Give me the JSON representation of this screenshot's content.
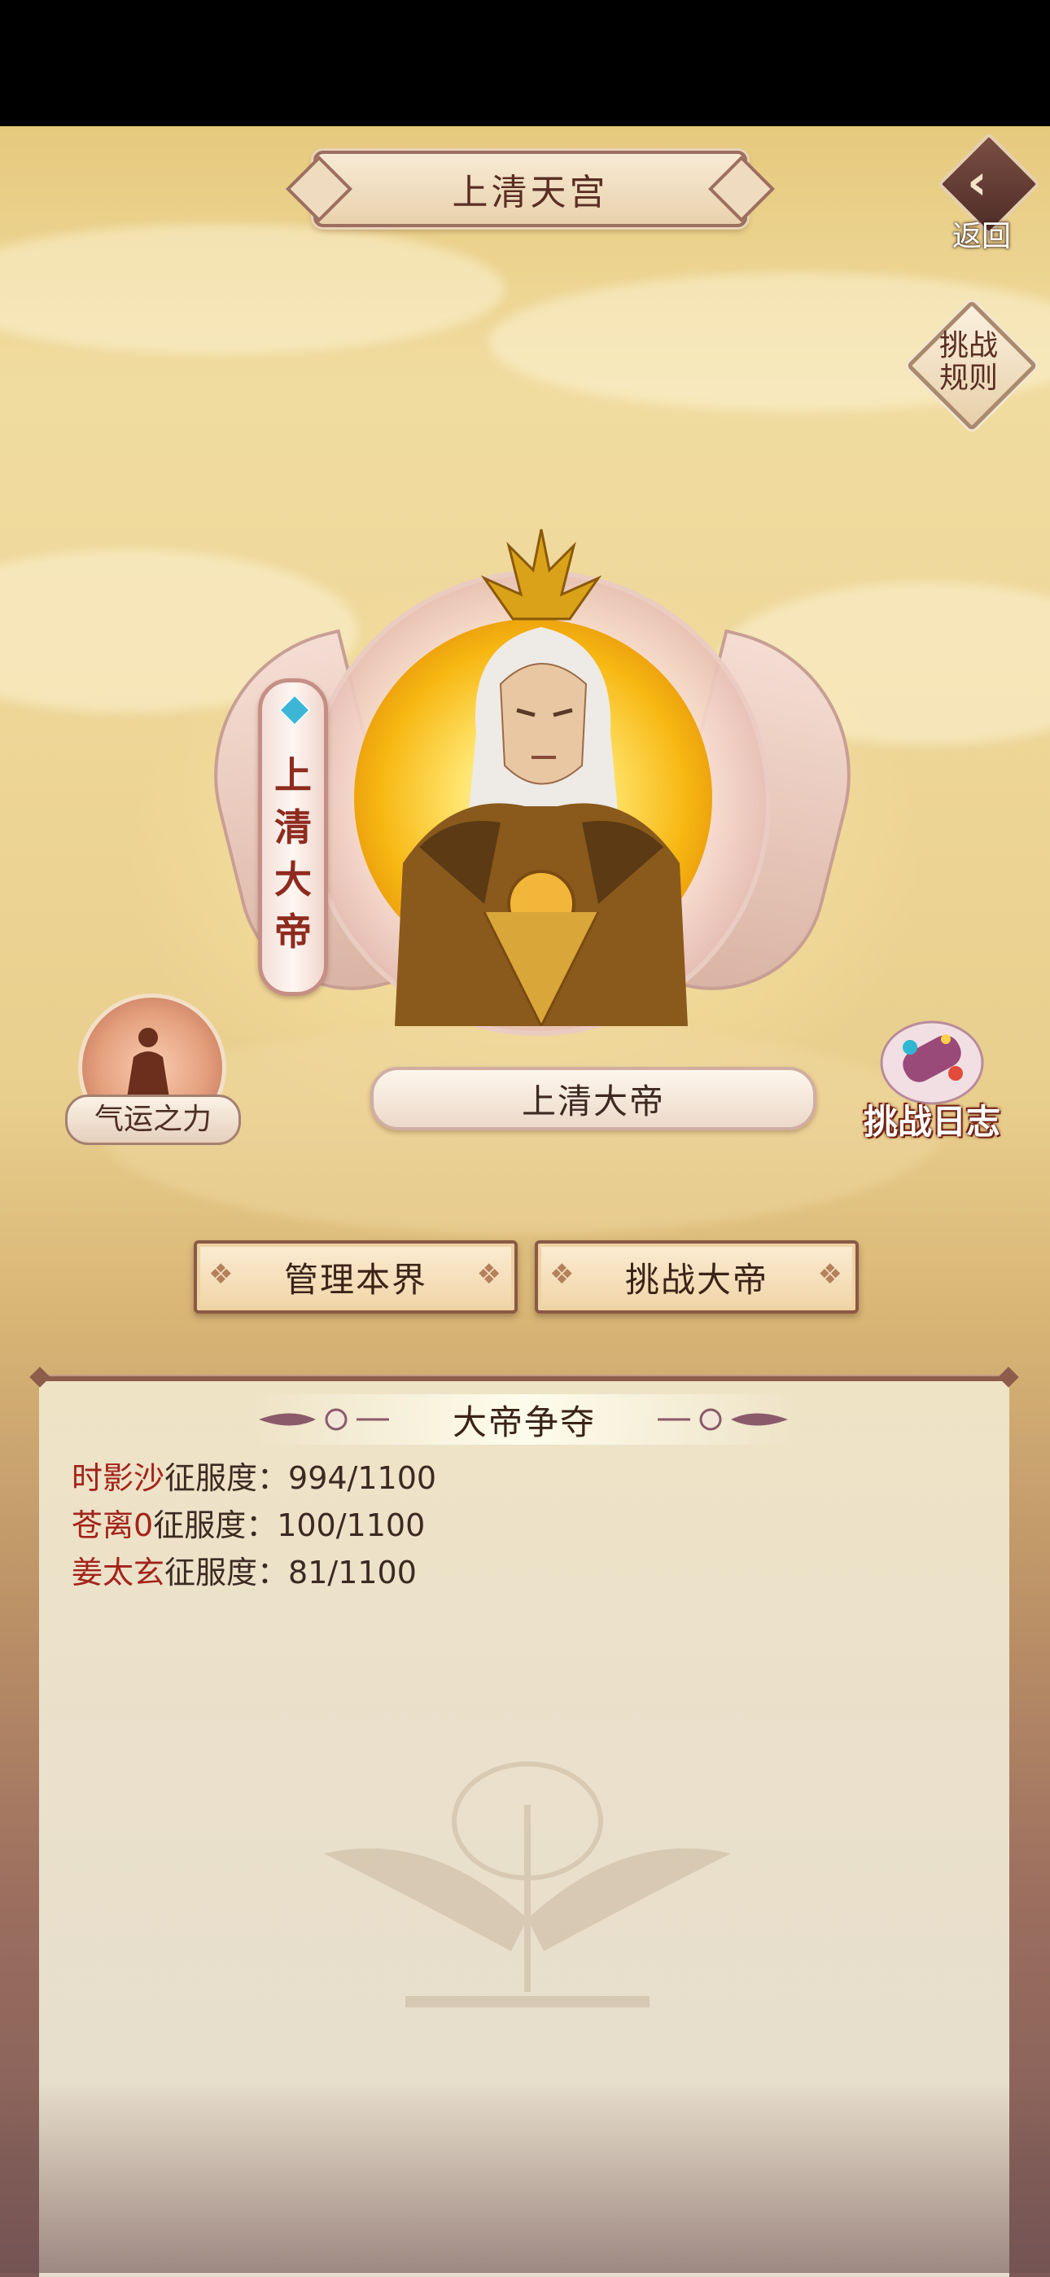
{
  "header": {
    "title": "上清天宫",
    "back_label": "返回",
    "rules_label_line1": "挑战",
    "rules_label_line2": "规则"
  },
  "hero": {
    "vertical_title": "上清大帝",
    "vertical_chars": [
      "上",
      "清",
      "大",
      "帝"
    ],
    "name": "上清大帝"
  },
  "side": {
    "fortune_label": "气运之力",
    "log_label": "挑战日志"
  },
  "actions": {
    "manage_label": "管理本界",
    "challenge_label": "挑战大帝"
  },
  "panel": {
    "title": "大帝争夺",
    "rows": [
      {
        "name": "时影沙",
        "label": "征服度：",
        "value": "994/1100"
      },
      {
        "name": "苍离0",
        "label": "征服度：",
        "value": "100/1100"
      },
      {
        "name": "姜太玄",
        "label": "征服度：",
        "value": "81/1100"
      }
    ]
  },
  "icons": {
    "back": "back-arrow-icon",
    "fortune": "meditating-figure-icon",
    "log": "scroll-icon"
  }
}
